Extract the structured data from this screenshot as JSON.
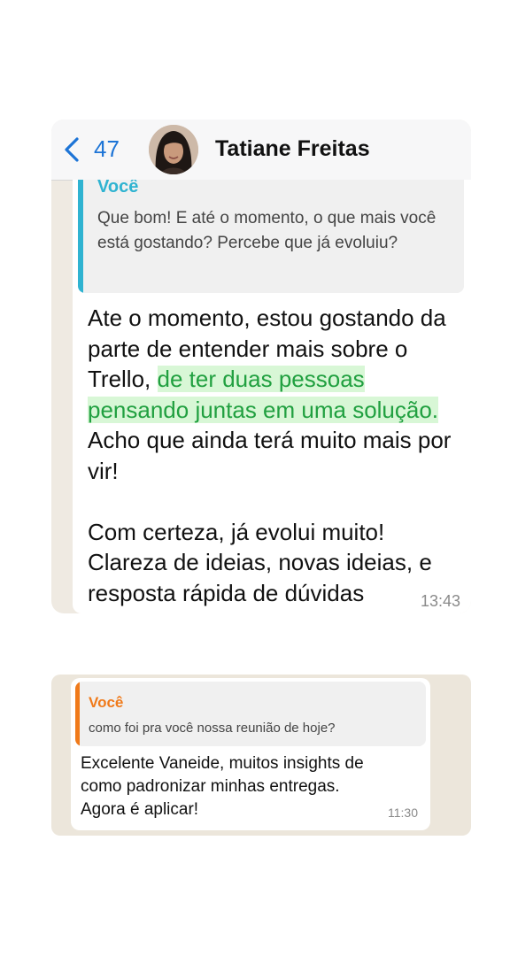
{
  "chat1": {
    "back_count": "47",
    "contact_name": "Tatiane Freitas",
    "quote": {
      "author": "Você",
      "text": "Que bom! E até o momento, o que mais você está gostando? Percebe que já evoluiu?"
    },
    "message": {
      "part1": "Ate o momento, estou gostando da parte de entender mais sobre o Trello, ",
      "highlight": "de ter duas pessoas pensando juntas em uma solução.",
      "part2": " Acho que ainda terá muito mais por vir!",
      "paragraph2": "Com certeza, já evolui muito! Clareza de ideias, novas ideias, e resposta rápida de dúvidas"
    },
    "time": "13:43"
  },
  "chat2": {
    "quote": {
      "author": "Você",
      "text": "como foi pra você nossa reunião de hoje?"
    },
    "message": "Excelente Vaneide,  muitos insights de como padronizar minhas entregas. Agora é aplicar!",
    "time": "11:30"
  },
  "colors": {
    "ios_blue": "#1d74d6",
    "quote_blue": "#2fb3d1",
    "quote_orange": "#f07a1a",
    "highlight_green": "#21a040",
    "highlight_bg": "#d8f7d6",
    "chat_background": "#efeae2"
  },
  "icons": {
    "back": "chevron-left-icon"
  }
}
